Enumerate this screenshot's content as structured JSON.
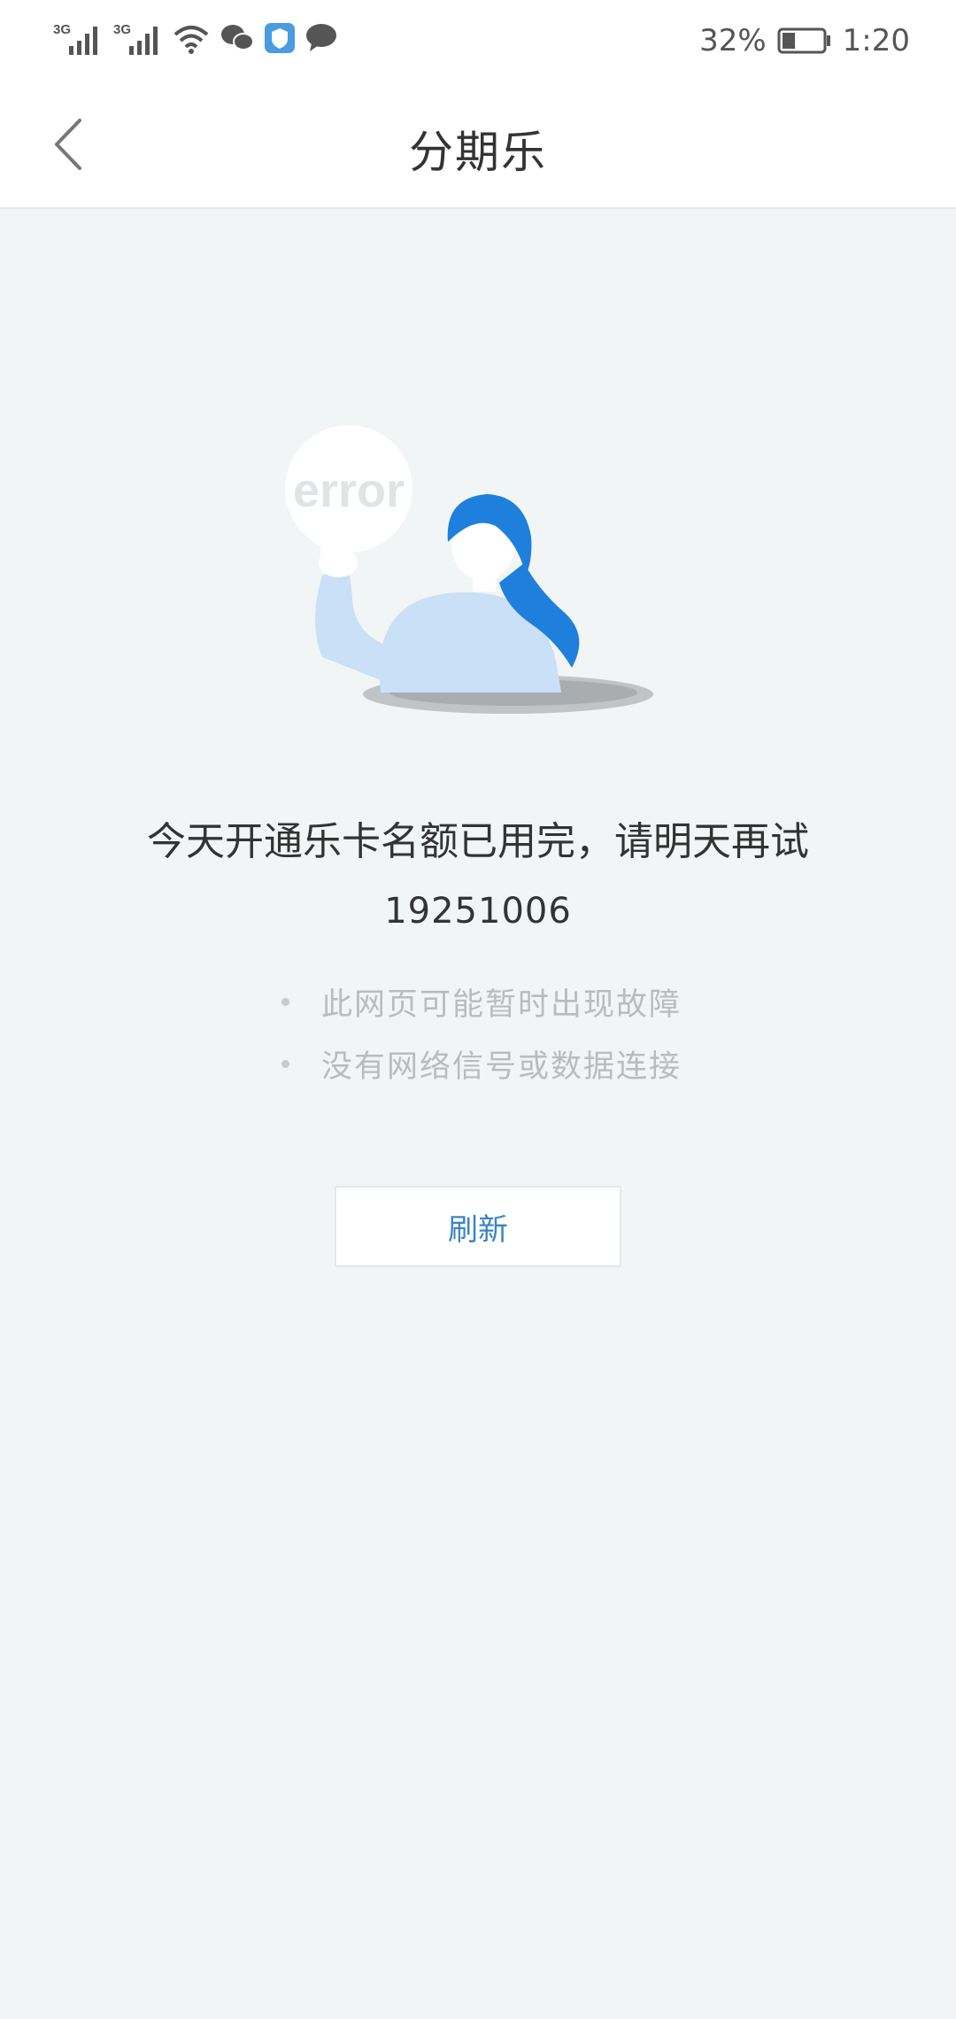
{
  "status_bar": {
    "network1": "3G",
    "network2": "3G",
    "battery_percent": "32%",
    "battery_level": 0.32,
    "time": "1:20"
  },
  "header": {
    "title": "分期乐",
    "back_icon": "chevron-left-icon"
  },
  "error": {
    "sign_text": "error",
    "message": "今天开通乐卡名额已用完，请明天再试",
    "code": "19251006",
    "tips": [
      "此网页可能暂时出现故障",
      "没有网络信号或数据连接"
    ],
    "refresh_label": "刷新"
  },
  "colors": {
    "background": "#f2f5f5",
    "accent": "#3a84c4",
    "hair": "#1f7fdc",
    "sweater": "#c9e0f7"
  }
}
